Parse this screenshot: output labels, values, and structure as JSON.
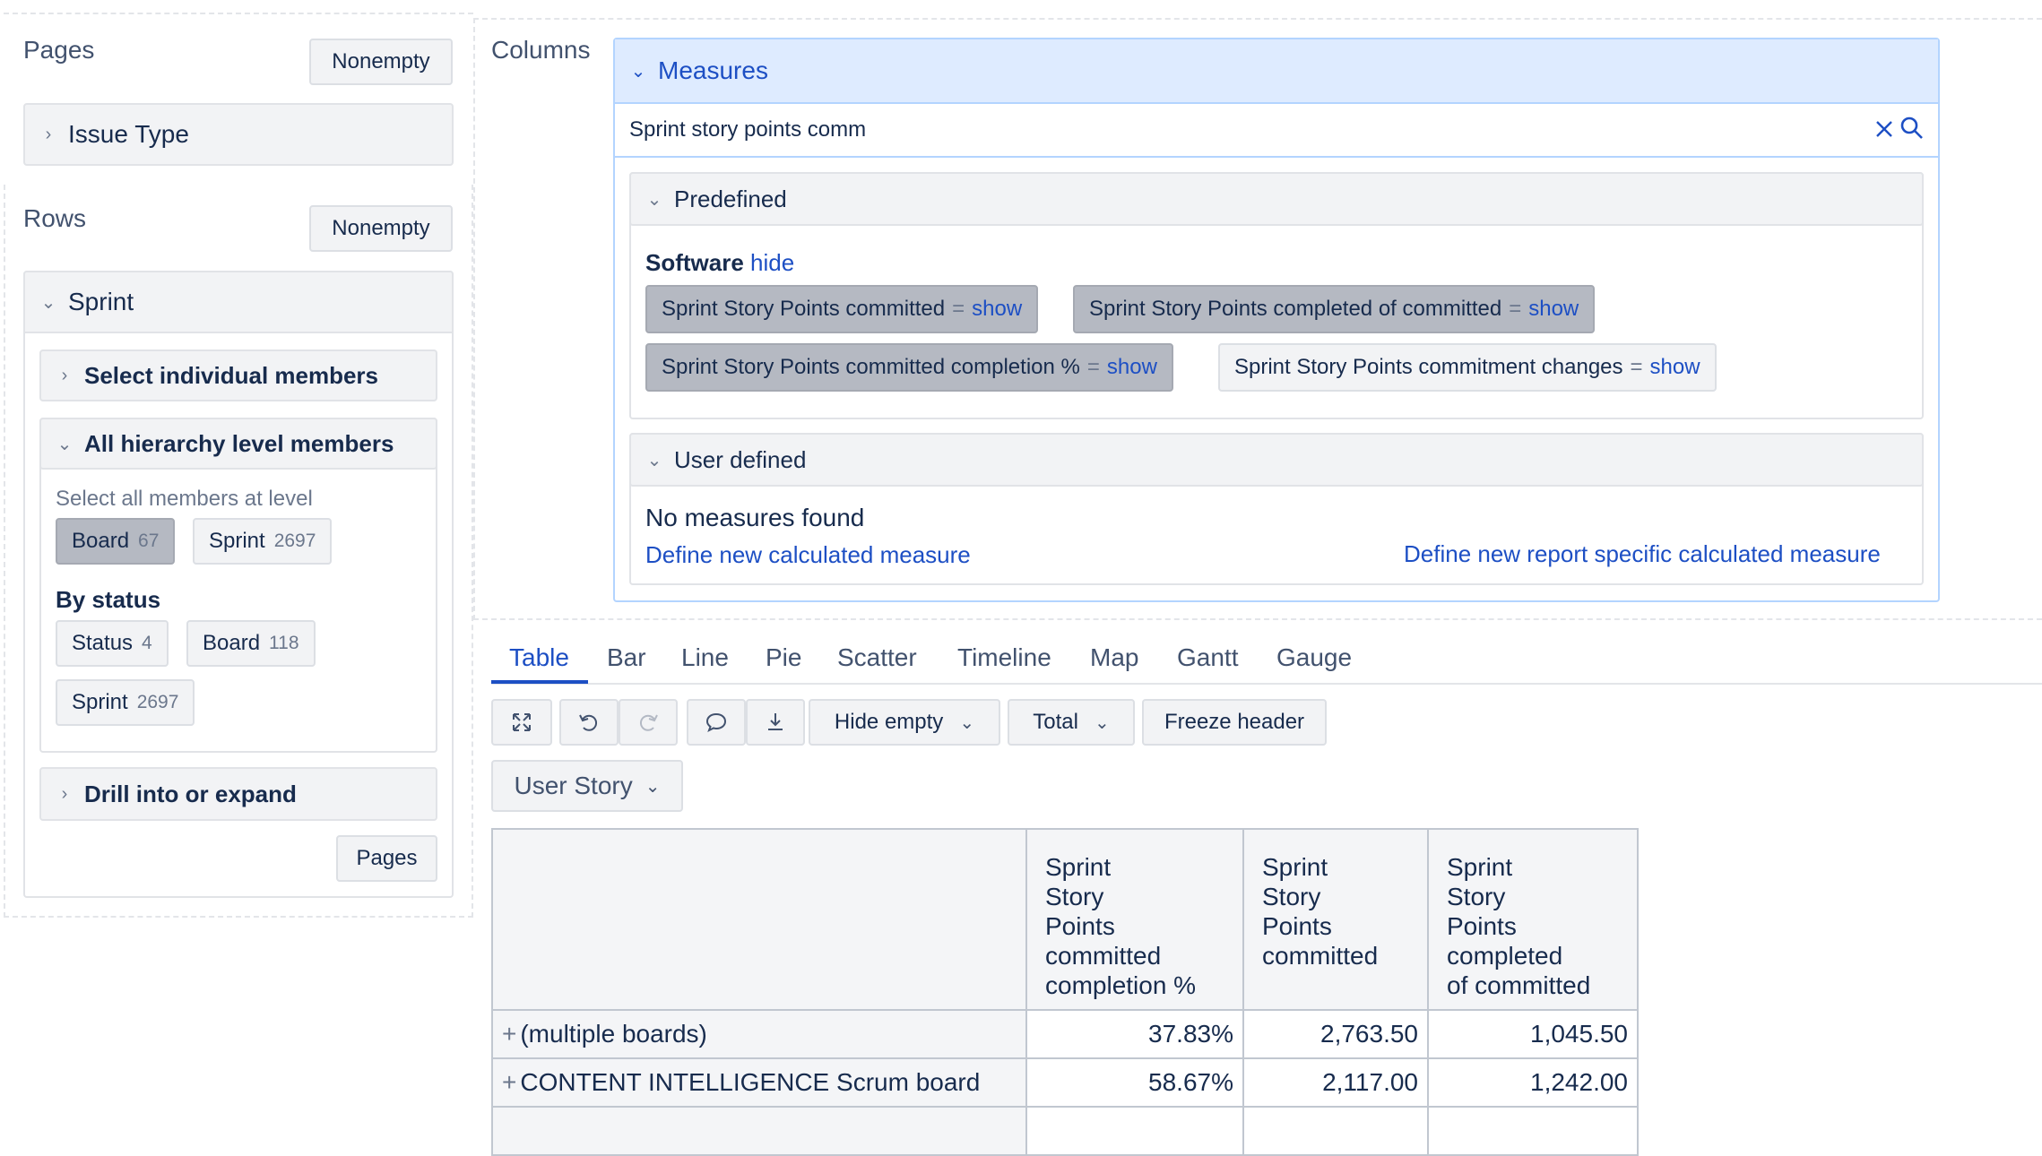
{
  "left": {
    "pages": {
      "label": "Pages",
      "nonempty": "Nonempty",
      "dimension": "Issue Type"
    },
    "rows": {
      "label": "Rows",
      "nonempty": "Nonempty",
      "dimension": "Sprint",
      "select_individual": "Select individual members",
      "all_hierarchy": "All hierarchy level members",
      "select_all_at_level": "Select all members at level",
      "levels": [
        {
          "label": "Board",
          "count": "67"
        },
        {
          "label": "Sprint",
          "count": "2697"
        }
      ],
      "by_status": "By status",
      "status_levels": [
        {
          "label": "Status",
          "count": "4"
        },
        {
          "label": "Board",
          "count": "118"
        },
        {
          "label": "Sprint",
          "count": "2697"
        }
      ],
      "drill": "Drill into or expand",
      "pages_button": "Pages"
    }
  },
  "columns": {
    "label": "Columns",
    "measures_title": "Measures",
    "search_value": "Sprint story points comm",
    "predefined": {
      "title": "Predefined",
      "group": "Software",
      "hide": "hide",
      "items": [
        {
          "label": "Sprint Story Points committed",
          "eq": "=",
          "show": "show"
        },
        {
          "label": "Sprint Story Points completed of committed",
          "eq": "=",
          "show": "show"
        },
        {
          "label": "Sprint Story Points committed completion %",
          "eq": "=",
          "show": "show"
        },
        {
          "label": "Sprint Story Points commitment changes",
          "eq": "=",
          "show": "show"
        }
      ]
    },
    "user_defined": {
      "title": "User defined",
      "empty": "No measures found",
      "define_calc": "Define new calculated measure",
      "define_report": "Define new report specific calculated measure"
    }
  },
  "view_tabs": [
    "Table",
    "Bar",
    "Line",
    "Pie",
    "Scatter",
    "Timeline",
    "Map",
    "Gantt",
    "Gauge"
  ],
  "toolbar": {
    "hide_empty": "Hide empty",
    "total": "Total",
    "freeze": "Freeze header",
    "issue_type_select": "User Story"
  },
  "table": {
    "headers": [
      "Sprint Story Points committed completion %",
      "Sprint Story Points committed",
      "Sprint Story Points completed of committed"
    ],
    "header_lines": [
      [
        "Sprint",
        "Story",
        "Points",
        "committed",
        "completion %"
      ],
      [
        "Sprint",
        "Story",
        "Points",
        "committed"
      ],
      [
        "Sprint",
        "Story",
        "Points",
        "completed",
        "of committed"
      ]
    ],
    "rows": [
      {
        "label": "(multiple boards)",
        "values": [
          "37.83%",
          "2,763.50",
          "1,045.50"
        ]
      },
      {
        "label": "CONTENT INTELLIGENCE Scrum board",
        "values": [
          "58.67%",
          "2,117.00",
          "1,242.00"
        ]
      }
    ]
  },
  "colors": {
    "accent": "#1d4fc4",
    "selected_chip": "#b5b9c2",
    "measures_header": "#deebff"
  }
}
